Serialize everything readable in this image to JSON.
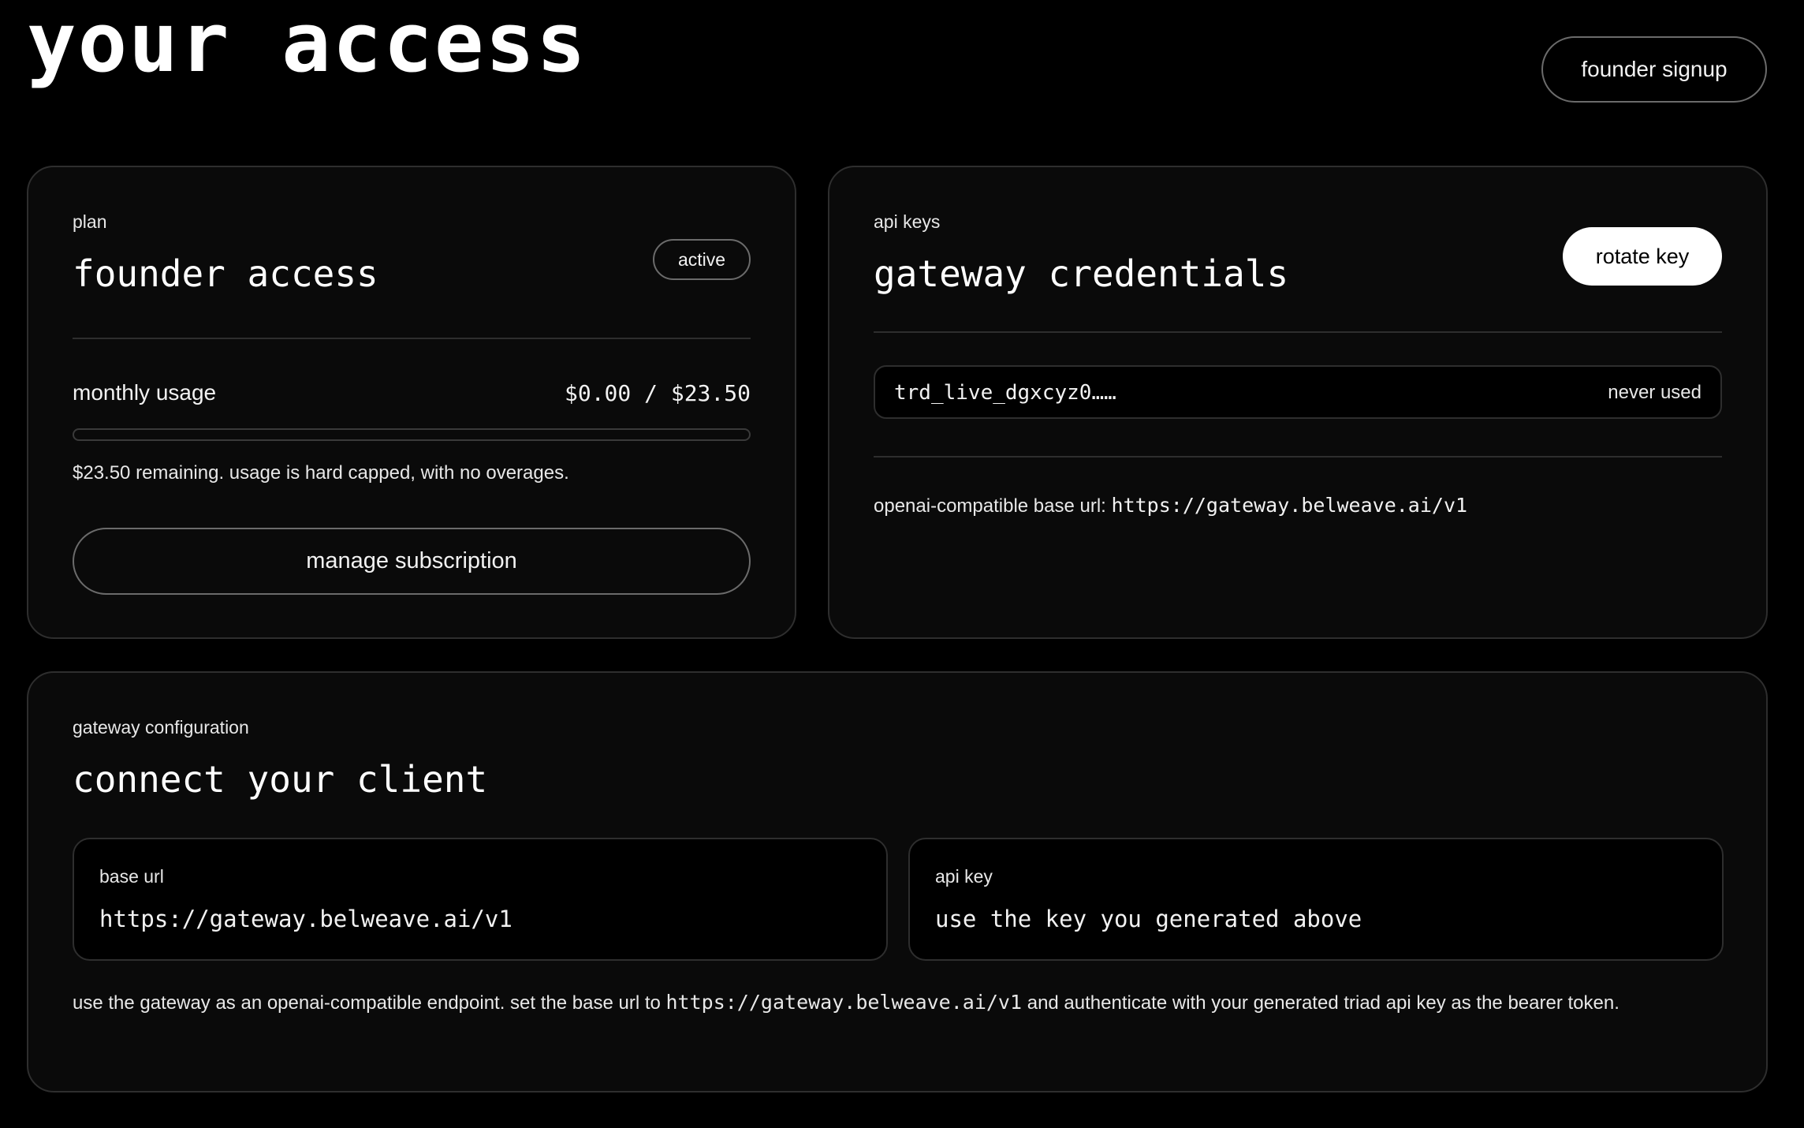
{
  "header": {
    "title": "your access",
    "signup_label": "founder signup"
  },
  "plan": {
    "eyebrow": "plan",
    "title": "founder access",
    "status_badge": "active",
    "usage_label": "monthly usage",
    "usage_value": "$0.00 / $23.50",
    "usage_fraction": 0,
    "remaining_note": "$23.50 remaining. usage is hard capped, with no overages.",
    "manage_label": "manage subscription"
  },
  "api_keys": {
    "eyebrow": "api keys",
    "title": "gateway credentials",
    "rotate_label": "rotate key",
    "key_masked": "trd_live_dgxcyz0……",
    "key_status": "never used",
    "base_url_label": "openai-compatible base url:",
    "base_url": "https://gateway.belweave.ai/v1"
  },
  "config": {
    "eyebrow": "gateway configuration",
    "title": "connect your client",
    "base_url_label": "base url",
    "base_url_value": "https://gateway.belweave.ai/v1",
    "api_key_label": "api key",
    "api_key_value": "use the key you generated above",
    "footnote_before": "use the gateway as an openai-compatible endpoint. set the base url to",
    "footnote_url": "https://gateway.belweave.ai/v1",
    "footnote_after": "and authenticate with your generated triad api key as the bearer token."
  },
  "colors": {
    "background": "#000000",
    "card": "#0a0a0a",
    "border": "#2e2e2e",
    "text": "#f2f2f2",
    "primary_button": "#ffffff"
  }
}
